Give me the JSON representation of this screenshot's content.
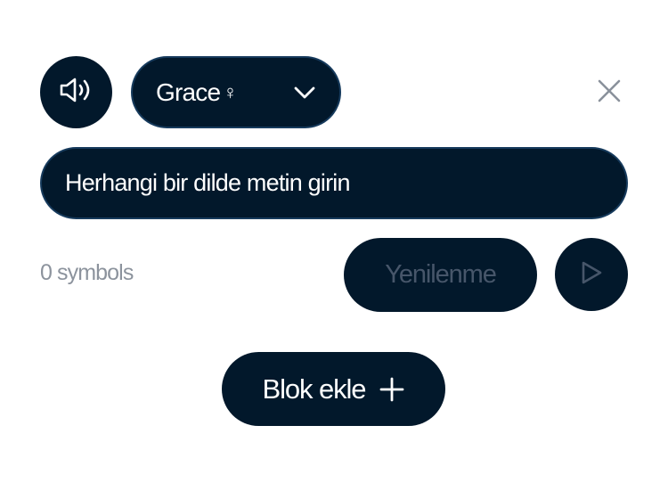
{
  "header": {
    "speaker_icon": "speaker-volume-icon",
    "voice_select": {
      "selected_voice": "Grace",
      "gender_symbol": "♀",
      "chevron_icon": "chevron-down-icon"
    },
    "close_icon": "close-icon"
  },
  "editor": {
    "placeholder": "Herhangi bir dilde metin girin",
    "value": ""
  },
  "controls": {
    "symbol_count": "0 symbols",
    "regenerate_label": "Yenilenme",
    "play_icon": "play-icon"
  },
  "footer": {
    "add_block_label": "Blok ekle",
    "plus_icon": "plus-icon"
  },
  "colors": {
    "button_bg": "#02182b",
    "border": "#163a5c",
    "muted_text": "#8c939d",
    "disabled_text": "#47566a",
    "close_icon": "#8a919b"
  }
}
